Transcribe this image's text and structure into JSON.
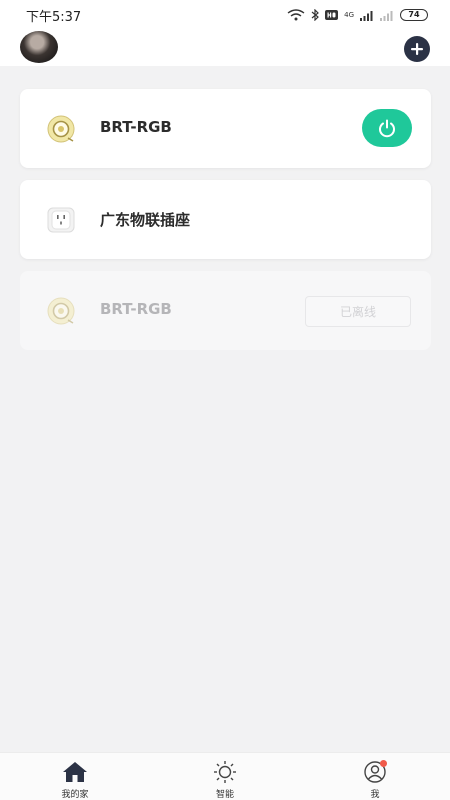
{
  "status_bar": {
    "time": "下午5:37",
    "network_label": "4G",
    "battery": "74"
  },
  "header": {
    "avatar_icon": "user-avatar",
    "add_icon": "plus-icon"
  },
  "devices": [
    {
      "name": "BRT-RGB",
      "icon": "bulb-icon",
      "state": "online",
      "control": "power-icon"
    },
    {
      "name": "广东物联插座",
      "icon": "socket-icon",
      "state": "online"
    },
    {
      "name": "BRT-RGB",
      "icon": "bulb-icon",
      "state": "offline",
      "status_label": "已离线"
    }
  ],
  "tabbar": {
    "items": [
      {
        "label": "我的家",
        "icon": "home-icon",
        "active": true
      },
      {
        "label": "智能",
        "icon": "sun-icon",
        "active": false
      },
      {
        "label": "我",
        "icon": "profile-icon",
        "active": false,
        "badge": true
      }
    ]
  },
  "colors": {
    "accent": "#1fc89a",
    "header_button": "#2b3245",
    "background": "#f2f2f3",
    "badge": "#f05a4a"
  }
}
